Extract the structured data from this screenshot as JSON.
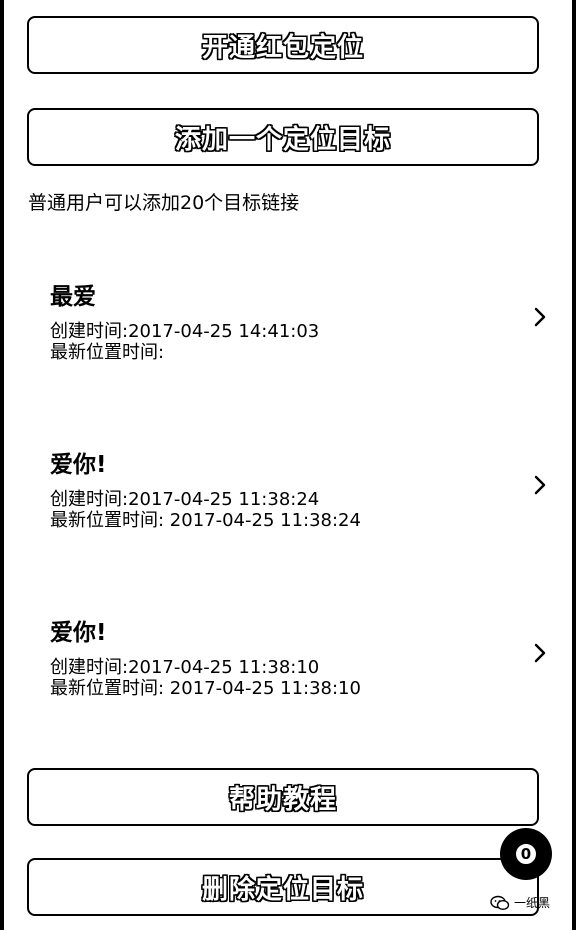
{
  "buttons": {
    "open_label": "开通红包定位",
    "add_label": "添加一个定位目标",
    "help_label": "帮助教程",
    "delete_label": "删除定位目标"
  },
  "note": "普通用户可以添加20个目标链接",
  "targets": [
    {
      "name": "最爱",
      "created": "创建时间:2017-04-25 14:41:03",
      "last_location": "最新位置时间:"
    },
    {
      "name": "爱你!",
      "created": "创建时间:2017-04-25 11:38:24",
      "last_location": "最新位置时间: 2017-04-25 11:38:24"
    },
    {
      "name": "爱你!",
      "created": "创建时间:2017-04-25 11:38:10",
      "last_location": "最新位置时间: 2017-04-25 11:38:10"
    }
  ],
  "floating_badge": {
    "count": "0"
  },
  "watermark": {
    "icon": "wechat-icon",
    "text": "一纸黑"
  }
}
